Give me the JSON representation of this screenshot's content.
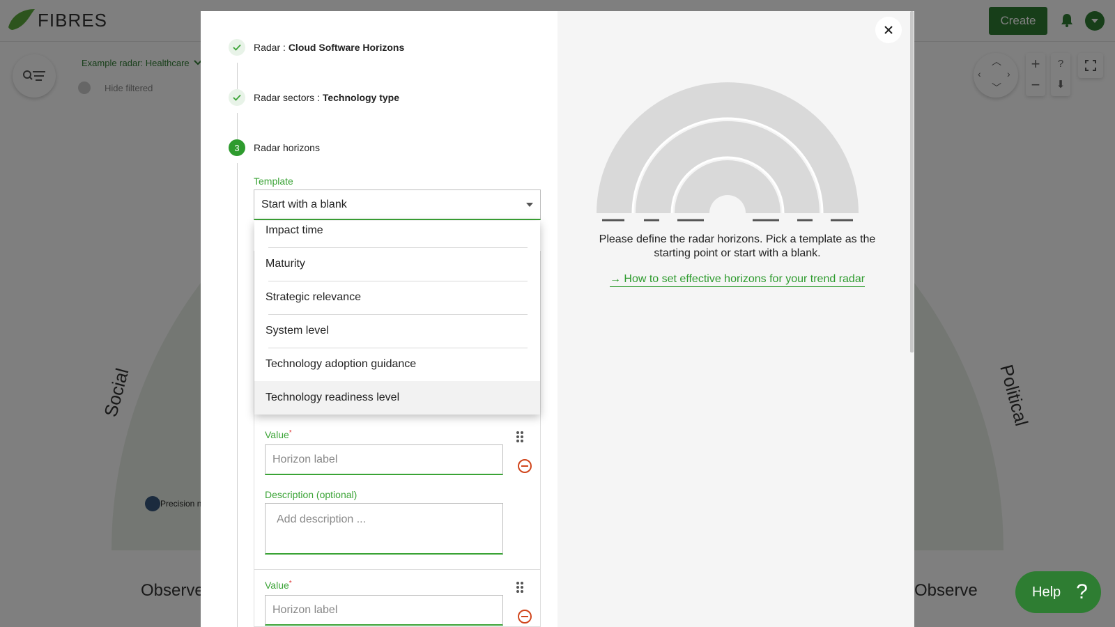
{
  "app": {
    "logo_text": "FIBRES",
    "create_label": "Create",
    "radar_select_label": "Example radar: Healthcare",
    "hide_filtered_label": "Hide filtered",
    "fullscreen_icon": "expand-icon",
    "help_button_label": "Help",
    "help_button_glyph": "?"
  },
  "background_radar": {
    "sector_left": "Social",
    "sector_right": "Political",
    "horizon_left": "Observe",
    "horizon_right": "Observe",
    "trend_label": "Precision n"
  },
  "modal": {
    "steps": [
      {
        "label": "Radar : ",
        "value": "Cloud Software Horizons",
        "status": "done"
      },
      {
        "label": "Radar sectors : ",
        "value": "Technology type",
        "status": "done"
      },
      {
        "number": "3",
        "label": "Radar horizons",
        "status": "active"
      }
    ],
    "template": {
      "label": "Template",
      "selected": "Start with a blank",
      "options": [
        "Impact time",
        "Maturity",
        "Strategic relevance",
        "System level",
        "Technology adoption guidance",
        "Technology readiness level"
      ],
      "highlighted_option": "Technology readiness level"
    },
    "horizon_rows": [
      {
        "value_label": "Value",
        "required_mark": "*",
        "value_placeholder": "Horizon label",
        "description_label": "Description (optional)",
        "description_placeholder": "Add description ..."
      },
      {
        "value_label": "Value",
        "required_mark": "*",
        "value_placeholder": "Horizon label"
      }
    ],
    "preview_text": "Please define the radar horizons. Pick a template as the starting point or start with a blank.",
    "guide_link": "→ How to set effective horizons for your trend radar",
    "colors": {
      "accent": "#2e9b2e",
      "brand_dark": "#2e7d32",
      "preview_fill": "#d9d9d9"
    }
  }
}
